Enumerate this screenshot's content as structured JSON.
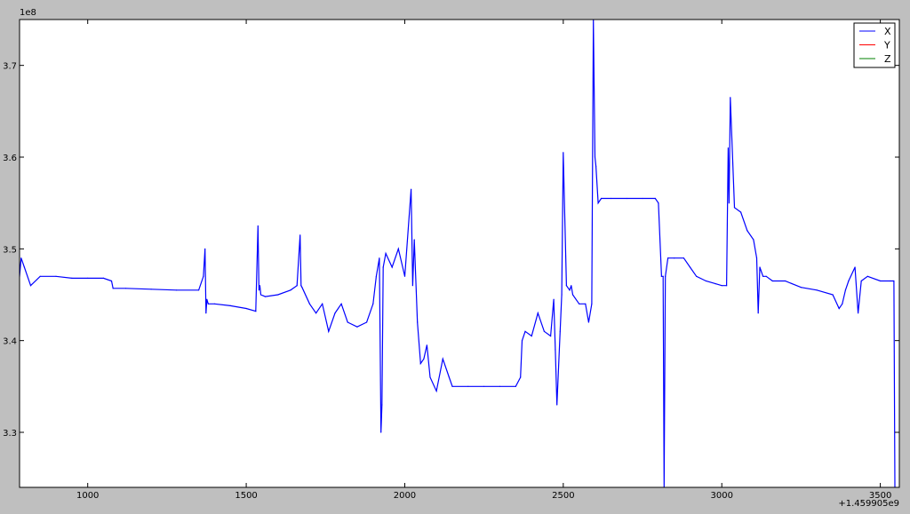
{
  "chart_data": {
    "type": "line",
    "title": "",
    "xlabel": "",
    "ylabel": "",
    "x_offset_label": "+1.459905e9",
    "y_scale_label": "1e8",
    "xlim": [
      785,
      3560
    ],
    "ylim": [
      3.24,
      3.75
    ],
    "x_ticks": [
      {
        "value": 1000,
        "label": "1000"
      },
      {
        "value": 1500,
        "label": "1500"
      },
      {
        "value": 2000,
        "label": "2000"
      },
      {
        "value": 2500,
        "label": "2500"
      },
      {
        "value": 3000,
        "label": "3000"
      },
      {
        "value": 3500,
        "label": "3500"
      }
    ],
    "y_ticks": [
      {
        "value": 3.3,
        "label": "3.3"
      },
      {
        "value": 3.4,
        "label": "3.4"
      },
      {
        "value": 3.5,
        "label": "3.5"
      },
      {
        "value": 3.6,
        "label": "3.6"
      },
      {
        "value": 3.7,
        "label": "3.7"
      }
    ],
    "legend": {
      "placement": "top-right"
    },
    "grid": false,
    "series": [
      {
        "name": "X",
        "color": "#0000ff",
        "x": [
          785,
          790,
          800,
          820,
          850,
          900,
          950,
          1000,
          1050,
          1075,
          1080,
          1120,
          1200,
          1280,
          1350,
          1365,
          1370,
          1373,
          1376,
          1380,
          1400,
          1450,
          1500,
          1530,
          1537,
          1540,
          1543,
          1546,
          1560,
          1600,
          1640,
          1660,
          1670,
          1673,
          1676,
          1700,
          1720,
          1740,
          1760,
          1780,
          1800,
          1820,
          1850,
          1880,
          1900,
          1910,
          1920,
          1925,
          1928,
          1932,
          1940,
          1960,
          1980,
          2000,
          2020,
          2025,
          2030,
          2040,
          2050,
          2060,
          2070,
          2080,
          2100,
          2120,
          2140,
          2150,
          2200,
          2250,
          2300,
          2350,
          2365,
          2370,
          2380,
          2400,
          2420,
          2440,
          2460,
          2470,
          2475,
          2480,
          2490,
          2495,
          2500,
          2510,
          2520,
          2525,
          2530,
          2550,
          2570,
          2580,
          2590,
          2595,
          2600,
          2603,
          2610,
          2620,
          2650,
          2700,
          2750,
          2790,
          2800,
          2810,
          2815,
          2818,
          2822,
          2830,
          2850,
          2880,
          2900,
          2920,
          2950,
          2980,
          3000,
          3015,
          3020,
          3023,
          3027,
          3040,
          3060,
          3080,
          3100,
          3110,
          3115,
          3120,
          3130,
          3140,
          3160,
          3200,
          3250,
          3300,
          3350,
          3370,
          3380,
          3390,
          3400,
          3420,
          3430,
          3440,
          3460,
          3500,
          3530,
          3540,
          3543,
          3546
        ],
        "values": [
          3.47,
          3.49,
          3.48,
          3.46,
          3.47,
          3.47,
          3.468,
          3.468,
          3.468,
          3.465,
          3.457,
          3.457,
          3.456,
          3.455,
          3.455,
          3.47,
          3.5,
          3.43,
          3.445,
          3.44,
          3.44,
          3.438,
          3.435,
          3.432,
          3.525,
          3.455,
          3.46,
          3.45,
          3.448,
          3.45,
          3.455,
          3.46,
          3.515,
          3.46,
          3.458,
          3.44,
          3.43,
          3.44,
          3.41,
          3.43,
          3.44,
          3.42,
          3.415,
          3.42,
          3.44,
          3.47,
          3.49,
          3.3,
          3.33,
          3.48,
          3.495,
          3.48,
          3.5,
          3.47,
          3.565,
          3.46,
          3.51,
          3.42,
          3.375,
          3.38,
          3.395,
          3.36,
          3.345,
          3.38,
          3.36,
          3.35,
          3.35,
          3.35,
          3.35,
          3.35,
          3.36,
          3.4,
          3.41,
          3.405,
          3.43,
          3.41,
          3.405,
          3.445,
          3.39,
          3.33,
          3.41,
          3.45,
          3.605,
          3.46,
          3.455,
          3.46,
          3.45,
          3.44,
          3.44,
          3.42,
          3.44,
          3.75,
          3.6,
          3.59,
          3.55,
          3.555,
          3.555,
          3.555,
          3.555,
          3.555,
          3.55,
          3.47,
          3.47,
          3.24,
          3.47,
          3.49,
          3.49,
          3.49,
          3.48,
          3.47,
          3.465,
          3.462,
          3.46,
          3.46,
          3.61,
          3.55,
          3.665,
          3.545,
          3.54,
          3.52,
          3.51,
          3.49,
          3.43,
          3.48,
          3.47,
          3.47,
          3.465,
          3.465,
          3.458,
          3.455,
          3.45,
          3.435,
          3.44,
          3.455,
          3.465,
          3.48,
          3.43,
          3.465,
          3.47,
          3.465,
          3.465,
          3.465,
          3.465,
          3.24
        ]
      },
      {
        "name": "Y",
        "color": "#ff0000",
        "x": [],
        "values": []
      },
      {
        "name": "Z",
        "color": "#008000",
        "x": [],
        "values": []
      }
    ]
  }
}
